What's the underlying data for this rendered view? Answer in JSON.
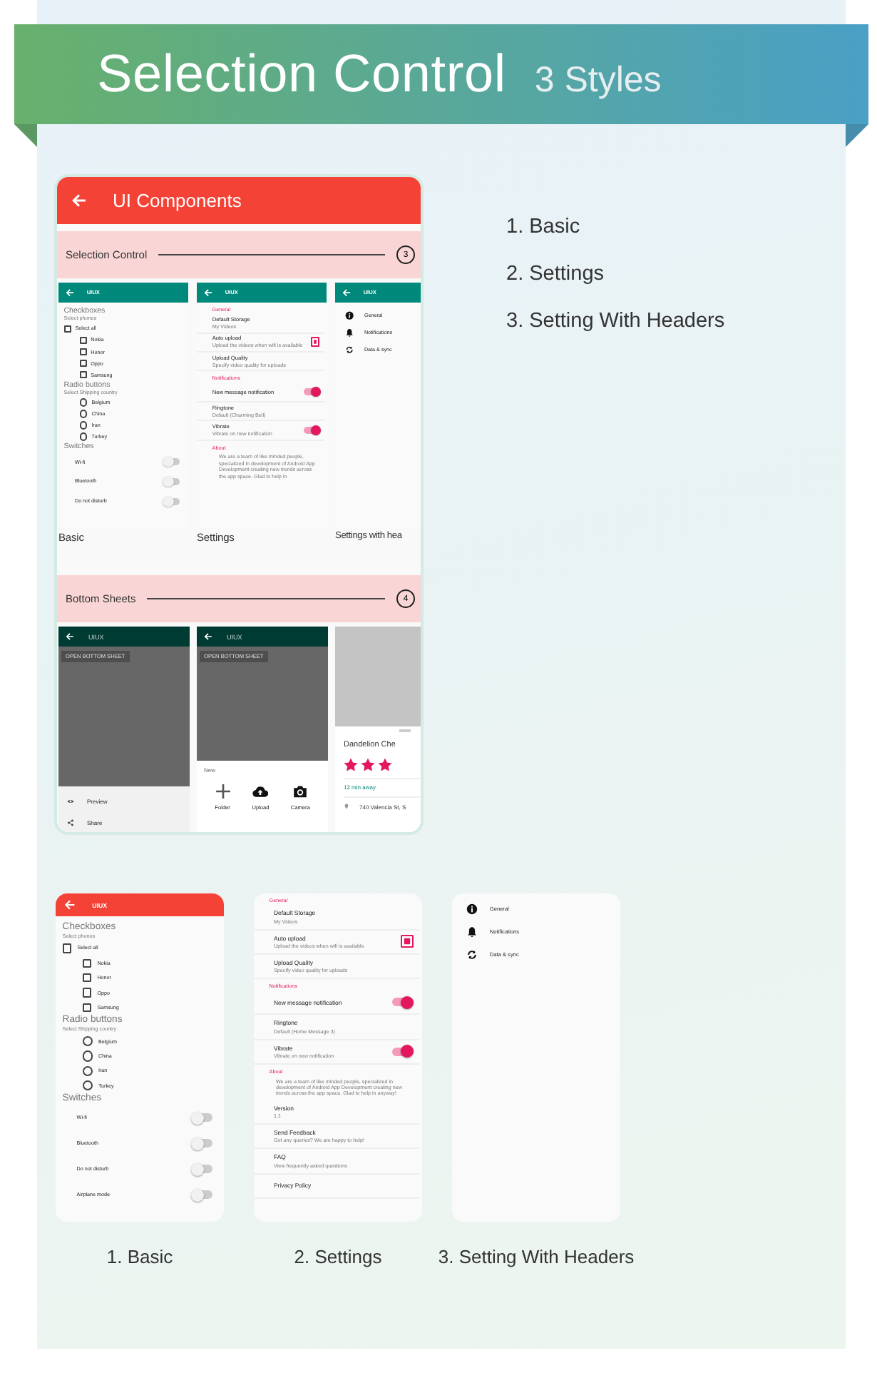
{
  "banner": {
    "title": "Selection Control",
    "subtitle": "3 Styles"
  },
  "demo_app": {
    "app_bar": {
      "title": "UI Components"
    },
    "sections": [
      {
        "title": "Selection Control",
        "count": "3",
        "previews": [
          {
            "kind": "basic",
            "caption": "Basic",
            "app_bar": {
              "title": "UIUX",
              "color": "#00897b"
            },
            "groups": [
              {
                "kind": "checkboxes",
                "title": "Checkboxes",
                "hint": "Select phones",
                "items": [
                  {
                    "label": "Select all",
                    "checked": false,
                    "children": [
                      {
                        "label": "Nokia",
                        "checked": false
                      },
                      {
                        "label": "Honor",
                        "checked": false
                      },
                      {
                        "label": "Oppo",
                        "checked": false
                      },
                      {
                        "label": "Samsung",
                        "checked": false
                      }
                    ]
                  }
                ]
              },
              {
                "kind": "radios",
                "title": "Radio buttons",
                "hint": "Select Shipping country",
                "items": [
                  {
                    "label": "Belgium",
                    "selected": false
                  },
                  {
                    "label": "China",
                    "selected": false
                  },
                  {
                    "label": "Iran",
                    "selected": false
                  },
                  {
                    "label": "Turkey",
                    "selected": false
                  }
                ]
              },
              {
                "kind": "switches",
                "title": "Switches",
                "items": [
                  {
                    "label": "Wi-fi",
                    "on": false
                  },
                  {
                    "label": "Bluetooth",
                    "on": false
                  },
                  {
                    "label": "Do not disturb",
                    "on": false
                  }
                ]
              }
            ]
          },
          {
            "kind": "settings",
            "caption": "Settings",
            "app_bar": {
              "title": "UIUX",
              "color": "#00897b"
            },
            "entries": [
              {
                "kind": "header",
                "title": "General"
              },
              {
                "kind": "row",
                "title": "Default Storage",
                "subtitle": "My Videos"
              },
              {
                "kind": "checkbox",
                "title": "Auto upload",
                "subtitle": "Upload the videos when wifi is available",
                "checked": true
              },
              {
                "kind": "row",
                "title": "Upload Quality",
                "subtitle": "Specify video quality for uploads"
              },
              {
                "kind": "header",
                "title": "Notifications"
              },
              {
                "kind": "switch",
                "title": "New message notification",
                "on": true
              },
              {
                "kind": "row",
                "title": "Ringtone",
                "subtitle": "Default (Charming Bell)"
              },
              {
                "kind": "switch",
                "title": "Vibrate",
                "subtitle": "Vibrate on new notification",
                "on": true
              },
              {
                "kind": "header",
                "title": "About"
              },
              {
                "kind": "paragraph",
                "title": "We are a team of like minded people, specialized in development of Android App Development creating new trends across the app space. Glad to help in"
              }
            ]
          },
          {
            "kind": "headers",
            "caption": "Settings with hea",
            "app_bar": {
              "title": "UIUX",
              "color": "#00897b"
            },
            "items": [
              {
                "label": "General"
              },
              {
                "label": "Notifications"
              },
              {
                "label": "Data & sync"
              }
            ]
          }
        ]
      },
      {
        "title": "Bottom Sheets",
        "count": "4",
        "previews": [
          {
            "kind": "list_sheet",
            "app_bar": {
              "title": "UIUX",
              "color": "#003b33"
            },
            "button": "OPEN BOTTOM SHEET",
            "items": [
              {
                "label": "Preview"
              },
              {
                "label": "Share"
              }
            ]
          },
          {
            "kind": "grid_sheet",
            "app_bar": {
              "title": "UIUX",
              "color": "#003b33"
            },
            "button": "OPEN BOTTOM SHEET",
            "title": "New",
            "items": [
              {
                "label": "Folder"
              },
              {
                "label": "Upload"
              },
              {
                "label": "Camera"
              }
            ]
          },
          {
            "kind": "place_sheet",
            "title": "Dandelion Che",
            "stars": 3,
            "distance": "12 min away",
            "address": "740 Valencia St, S"
          }
        ]
      }
    ]
  },
  "style_list": [
    "1. Basic",
    "2. Settings",
    "3. Setting With Headers"
  ],
  "screens": [
    {
      "kind": "basic",
      "caption": "1. Basic",
      "app_bar": {
        "title": "UIUX",
        "color": "#f44336"
      },
      "groups": [
        {
          "kind": "checkboxes",
          "title": "Checkboxes",
          "hint": "Select phones",
          "items": [
            {
              "label": "Select all",
              "checked": false,
              "children": [
                {
                  "label": "Nokia",
                  "checked": false
                },
                {
                  "label": "Honor",
                  "checked": false
                },
                {
                  "label": "Oppo",
                  "checked": false
                },
                {
                  "label": "Samsung",
                  "checked": false
                }
              ]
            }
          ]
        },
        {
          "kind": "radios",
          "title": "Radio buttons",
          "hint": "Select Shipping country",
          "items": [
            {
              "label": "Belgium",
              "selected": false
            },
            {
              "label": "China",
              "selected": false
            },
            {
              "label": "Iran",
              "selected": false
            },
            {
              "label": "Turkey",
              "selected": false
            }
          ]
        },
        {
          "kind": "switches",
          "title": "Switches",
          "items": [
            {
              "label": "Wi-fi",
              "on": false
            },
            {
              "label": "Bluetooth",
              "on": false
            },
            {
              "label": "Do not disturb",
              "on": false
            },
            {
              "label": "Airplane mode",
              "on": false
            }
          ]
        }
      ]
    },
    {
      "kind": "settings",
      "caption": "2. Settings",
      "entries": [
        {
          "kind": "header",
          "title": "General"
        },
        {
          "kind": "row",
          "title": "Default Storage",
          "subtitle": "My Videos"
        },
        {
          "kind": "checkbox",
          "title": "Auto upload",
          "subtitle": "Upload the videos when wifi is available",
          "checked": true
        },
        {
          "kind": "row",
          "title": "Upload Quality",
          "subtitle": "Specify video quality for uploads"
        },
        {
          "kind": "header",
          "title": "Notifications"
        },
        {
          "kind": "switch",
          "title": "New message notification",
          "on": true
        },
        {
          "kind": "row",
          "title": "Ringtone",
          "subtitle": "Default (Home Message 3)"
        },
        {
          "kind": "switch",
          "title": "Vibrate",
          "subtitle": "Vibrate on new notification",
          "on": true
        },
        {
          "kind": "header",
          "title": "About"
        },
        {
          "kind": "paragraph",
          "title": "We are a team of like minded people, specialized in development of Android App Development creating new trends across the app space. Glad to help in anyway!"
        },
        {
          "kind": "row",
          "title": "Version",
          "subtitle": "1.1"
        },
        {
          "kind": "row",
          "title": "Send Feedback",
          "subtitle": "Got any queries? We are happy to help!"
        },
        {
          "kind": "row",
          "title": "FAQ",
          "subtitle": "View frequently asked questions"
        },
        {
          "kind": "row",
          "title": "Privacy Policy"
        }
      ]
    },
    {
      "kind": "headers",
      "caption": "3. Setting With Headers",
      "items": [
        {
          "label": "General"
        },
        {
          "label": "Notifications"
        },
        {
          "label": "Data & sync"
        }
      ]
    }
  ]
}
